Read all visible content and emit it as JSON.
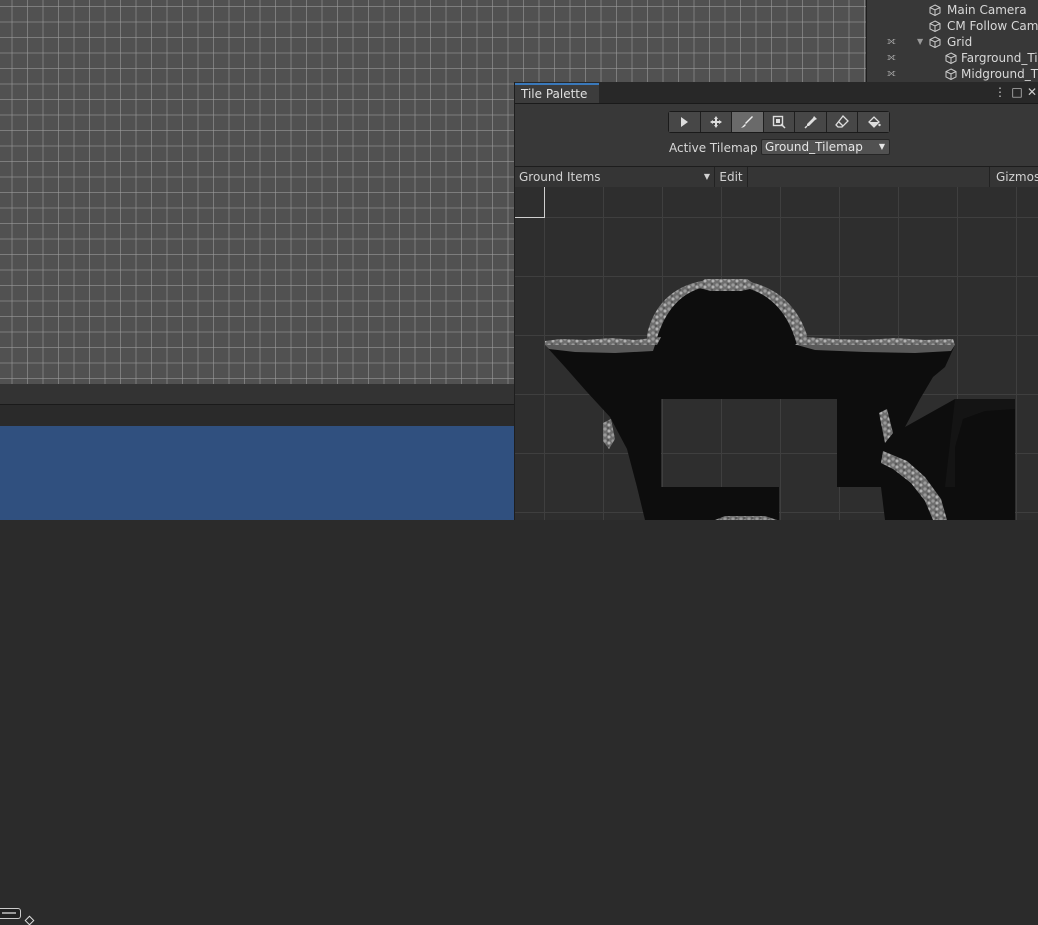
{
  "hierarchy": {
    "items": [
      {
        "label": "Main Camera"
      },
      {
        "label": "CM Follow Cam"
      },
      {
        "label": "Grid"
      },
      {
        "label": "Farground_Tile"
      },
      {
        "label": "Midground_Ti"
      }
    ]
  },
  "tile_palette": {
    "tab_label": "Tile Palette",
    "window_buttons": {
      "menu": "⋮",
      "maximize": "□",
      "close": "✕"
    },
    "tools": [
      {
        "name": "select-tool",
        "icon": "arrow-icon",
        "selected": false
      },
      {
        "name": "move-tool",
        "icon": "move-icon",
        "selected": false
      },
      {
        "name": "paint-tool",
        "icon": "brush-icon",
        "selected": true
      },
      {
        "name": "box-fill-tool",
        "icon": "box-fill-icon",
        "selected": false
      },
      {
        "name": "pick-tool",
        "icon": "eyedropper-icon",
        "selected": false
      },
      {
        "name": "erase-tool",
        "icon": "eraser-icon",
        "selected": false
      },
      {
        "name": "fill-tool",
        "icon": "bucket-icon",
        "selected": false
      }
    ],
    "active_tilemap_label": "Active Tilemap",
    "active_tilemap_value": "Ground_Tilemap",
    "palette_value": "Ground Items",
    "edit_label": "Edit",
    "gizmos_label": "Gizmos"
  },
  "colors": {
    "tab_accent": "#3a79bb",
    "game_view_background": "#30507f",
    "scene_grid_background": "#515151"
  }
}
